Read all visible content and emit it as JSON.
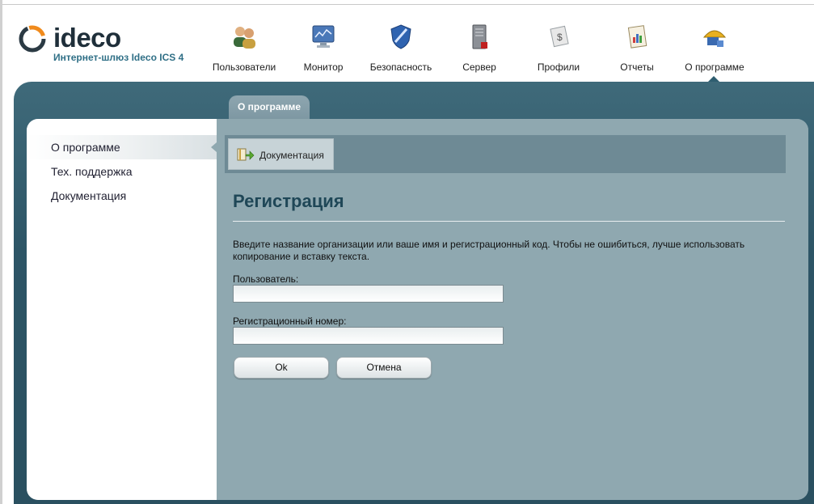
{
  "brand": {
    "name": "ideco",
    "subtitle": "Интернет-шлюз Ideco ICS 4"
  },
  "nav": [
    {
      "label": "Пользователи",
      "icon": "users-icon"
    },
    {
      "label": "Монитор",
      "icon": "monitor-icon"
    },
    {
      "label": "Безопасность",
      "icon": "shield-icon"
    },
    {
      "label": "Сервер",
      "icon": "server-icon"
    },
    {
      "label": "Профили",
      "icon": "profile-document-icon"
    },
    {
      "label": "Отчеты",
      "icon": "report-chart-icon"
    },
    {
      "label": "О программе",
      "icon": "about-umbrella-icon",
      "active": true
    }
  ],
  "tab": {
    "label": "О программе"
  },
  "sidebar": {
    "items": [
      {
        "label": "О программе",
        "active": true
      },
      {
        "label": "Тех. поддержка"
      },
      {
        "label": "Документация"
      }
    ]
  },
  "toolbar": {
    "documentation_label": "Документация"
  },
  "main": {
    "title": "Регистрация",
    "description": "Введите название организации или ваше имя и регистрационный код. Чтобы не ошибиться, лучше использовать копирование и вставку текста.",
    "user_label": "Пользователь:",
    "user_value": "",
    "regnum_label": "Регистрационный номер:",
    "regnum_value": "",
    "ok_label": "Ok",
    "cancel_label": "Отмена"
  }
}
